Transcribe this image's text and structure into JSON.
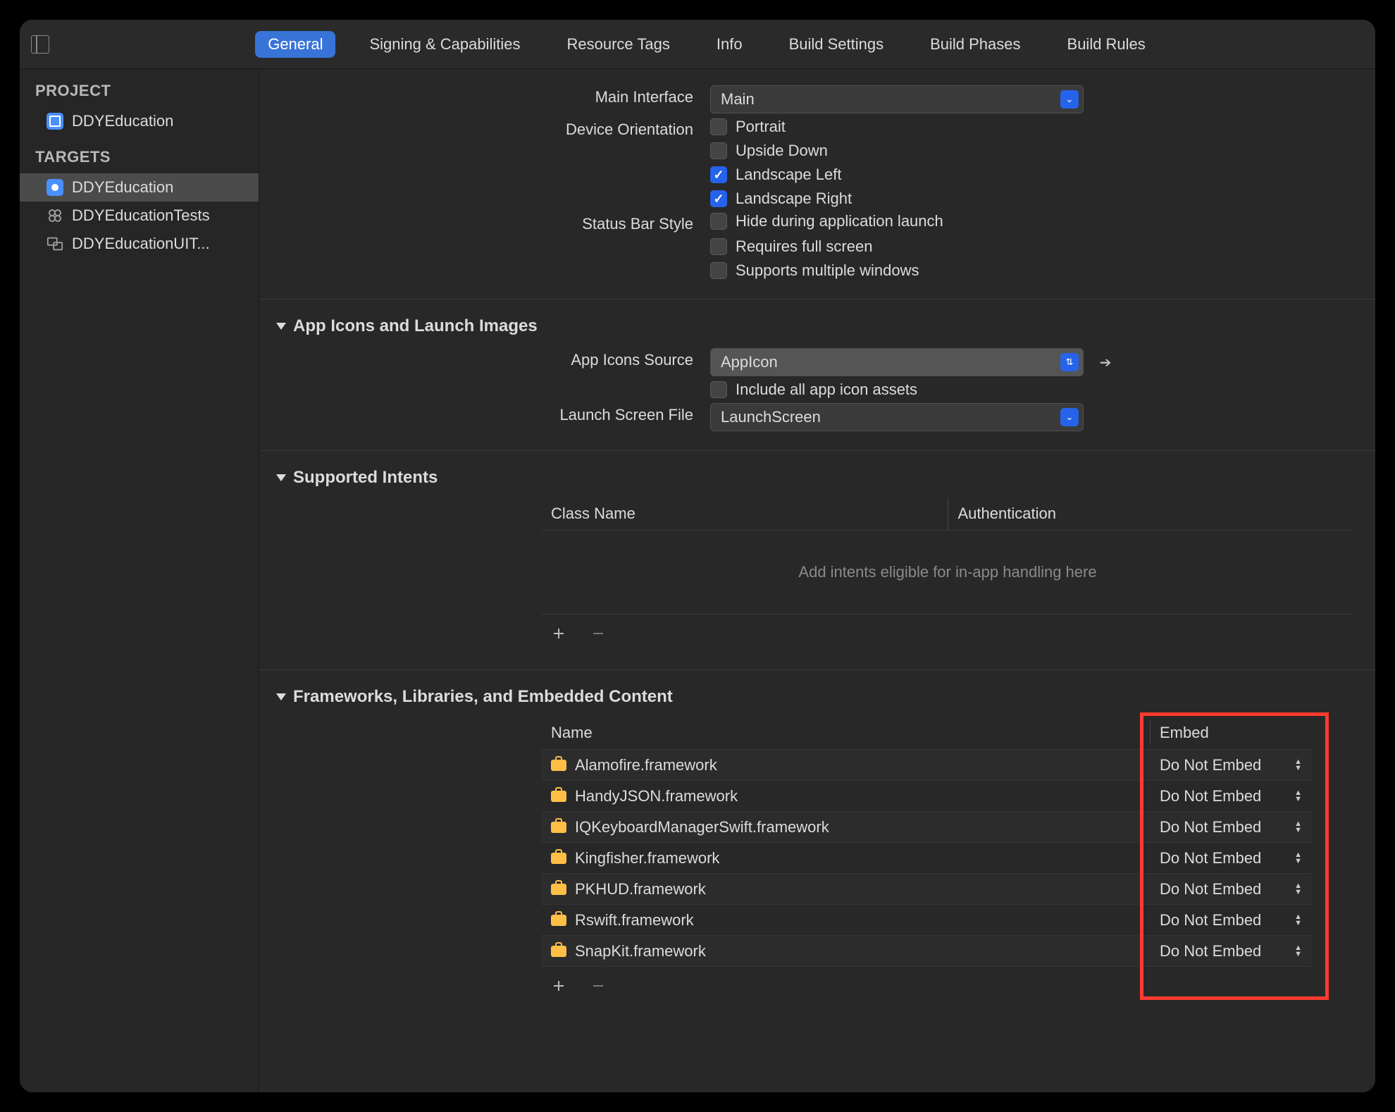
{
  "tabs": [
    "General",
    "Signing & Capabilities",
    "Resource Tags",
    "Info",
    "Build Settings",
    "Build Phases",
    "Build Rules"
  ],
  "selectedTab": 0,
  "sidebar": {
    "projectHeader": "PROJECT",
    "targetsHeader": "TARGETS",
    "project": "DDYEducation",
    "targets": [
      "DDYEducation",
      "DDYEducationTests",
      "DDYEducationUIT..."
    ],
    "selectedTarget": 0
  },
  "deployment": {
    "mainInterfaceLabel": "Main Interface",
    "mainInterfaceValue": "Main",
    "deviceOrientationLabel": "Device Orientation",
    "orientations": [
      {
        "label": "Portrait",
        "checked": false
      },
      {
        "label": "Upside Down",
        "checked": false
      },
      {
        "label": "Landscape Left",
        "checked": true
      },
      {
        "label": "Landscape Right",
        "checked": true
      }
    ],
    "statusBarLabel": "Status Bar Style",
    "statusBarChecks": [
      {
        "label": "Hide during application launch",
        "checked": false
      },
      {
        "label": "Requires full screen",
        "checked": false
      },
      {
        "label": "Supports multiple windows",
        "checked": false
      }
    ]
  },
  "appIcons": {
    "sectionTitle": "App Icons and Launch Images",
    "sourceLabel": "App Icons Source",
    "sourceValue": "AppIcon",
    "includeAllLabel": "Include all app icon assets",
    "includeAllChecked": false,
    "launchScreenLabel": "Launch Screen File",
    "launchScreenValue": "LaunchScreen"
  },
  "intents": {
    "sectionTitle": "Supported Intents",
    "col1": "Class Name",
    "col2": "Authentication",
    "emptyText": "Add intents eligible for in-app handling here"
  },
  "frameworks": {
    "sectionTitle": "Frameworks, Libraries, and Embedded Content",
    "col1": "Name",
    "col2": "Embed",
    "rows": [
      {
        "name": "Alamofire.framework",
        "embed": "Do Not Embed"
      },
      {
        "name": "HandyJSON.framework",
        "embed": "Do Not Embed"
      },
      {
        "name": "IQKeyboardManagerSwift.framework",
        "embed": "Do Not Embed"
      },
      {
        "name": "Kingfisher.framework",
        "embed": "Do Not Embed"
      },
      {
        "name": "PKHUD.framework",
        "embed": "Do Not Embed"
      },
      {
        "name": "Rswift.framework",
        "embed": "Do Not Embed"
      },
      {
        "name": "SnapKit.framework",
        "embed": "Do Not Embed"
      }
    ]
  }
}
